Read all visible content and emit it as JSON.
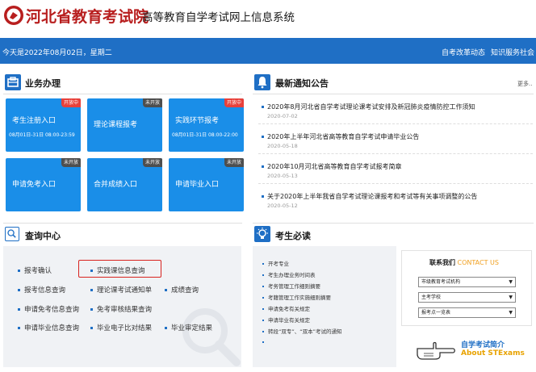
{
  "header": {
    "org_name": "河北省教育考试院",
    "system_name": "高等教育自学考试网上信息系统"
  },
  "topbar": {
    "date_text": "今天是2022年08月02日，星期二",
    "links": [
      "自考改革动态",
      "知识服务社会"
    ]
  },
  "business": {
    "title": "业务办理",
    "tiles": [
      {
        "label": "考生注册入口",
        "date": "08月01日-31日 08:00-23:59",
        "badge": "开放中",
        "badge_type": "open"
      },
      {
        "label": "理论课程报考",
        "date": "",
        "badge": "未开放",
        "badge_type": "closed"
      },
      {
        "label": "实践环节报考",
        "date": "08月01日-31日 08:00-22:00",
        "badge": "开放中",
        "badge_type": "open"
      },
      {
        "label": "申请免考入口",
        "date": "",
        "badge": "未开放",
        "badge_type": "closed"
      },
      {
        "label": "合并成绩入口",
        "date": "",
        "badge": "未开放",
        "badge_type": "closed"
      },
      {
        "label": "申请毕业入口",
        "date": "",
        "badge": "未开放",
        "badge_type": "closed"
      }
    ]
  },
  "notices": {
    "title": "最新通知公告",
    "more": "更多..",
    "items": [
      {
        "title": "2020年8月河北省自学考试理论课考试安排及新冠肺炎疫情防控工作须知",
        "date": "2020-07-02"
      },
      {
        "title": "2020年上半年河北省高等教育自学考试申请毕业公告",
        "date": "2020-05-18"
      },
      {
        "title": "2020年10月河北省高等教育自学考试报考简章",
        "date": "2020-05-13"
      },
      {
        "title": "关于2020年上半年我省自学考试理论课报考和考试等有关事项调整的公告",
        "date": "2020-05-12"
      }
    ]
  },
  "query": {
    "title": "查询中心",
    "items": [
      [
        "报考确认",
        "实践课信息查询",
        ""
      ],
      [
        "报考信息查询",
        "理论课考试通知单",
        "成绩查询"
      ],
      [
        "申请免考信息查询",
        "免考审核结果查询",
        ""
      ],
      [
        "申请毕业信息查询",
        "毕业电子比对结果",
        "毕业审定结果"
      ]
    ]
  },
  "exam": {
    "title": "考生必读",
    "items": [
      "开考专业",
      "考生办理业务时间表",
      "考务管理工作细则摘要",
      "考籍管理工作实施细则摘要",
      "申请免考有关规定",
      "申请毕业有关规定",
      "转段“双专”、“双本”考试的通知",
      ""
    ]
  },
  "contact": {
    "title_cn": "联系我们",
    "title_en": "CONTACT US",
    "selects": [
      "市级教育考试机构",
      "主考学校",
      "报考点一览表"
    ],
    "intro_cn": "自学考试简介",
    "intro_en": "About STExams"
  },
  "colors": {
    "brand_blue": "#1f6fc5",
    "tile_blue": "#1a8ee8",
    "brand_red": "#b81e1e",
    "badge_open": "#e8403a",
    "badge_closed": "#4e4e4e",
    "highlight": "#d8231f",
    "contact_en": "#f0a020"
  }
}
